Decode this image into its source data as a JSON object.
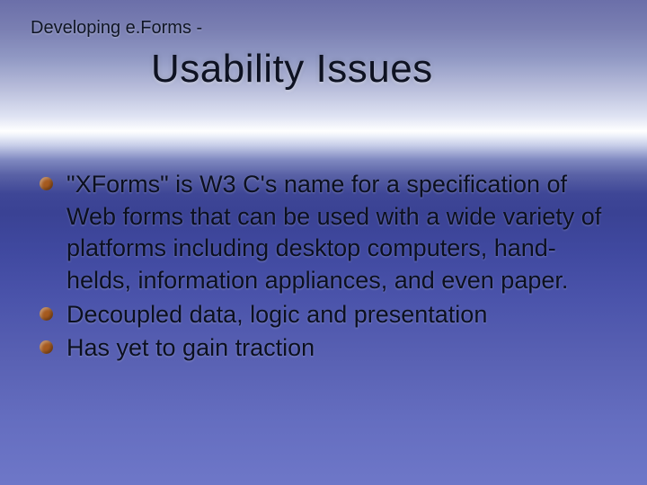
{
  "pretitle": "Developing e.Forms -",
  "title": "Usability Issues",
  "bullets": [
    "\"XForms\" is W3 C's name for a specification of Web forms that can be used with a wide variety of platforms including desktop computers, hand-helds, information appliances, and even paper.",
    "Decoupled data, logic and presentation",
    "Has yet to gain traction"
  ]
}
